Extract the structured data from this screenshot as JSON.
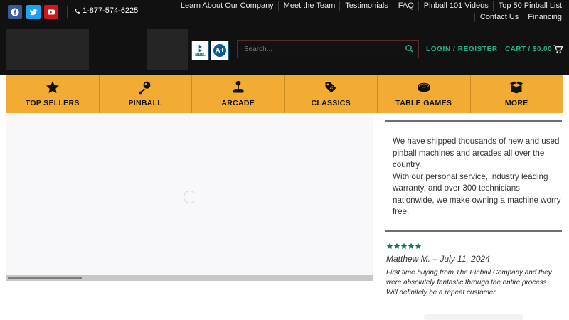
{
  "topbar": {
    "phone": "1-877-574-6225",
    "social": [
      "facebook-icon",
      "twitter-icon",
      "youtube-icon"
    ],
    "links": [
      "Learn About Our Company",
      "Meet the Team",
      "Testimonials",
      "FAQ",
      "Pinball 101 Videos",
      "Top 50 Pinball List",
      "Contact Us",
      "Financing"
    ]
  },
  "header": {
    "bbb_text": "BBB.",
    "bbb_rating": "A+",
    "search_placeholder": "Search...",
    "login": "LOGIN / REGISTER",
    "cart": "CART / $0.00"
  },
  "categories": [
    {
      "label": "TOP SELLERS",
      "icon": "star-icon"
    },
    {
      "label": "PINBALL",
      "icon": "pinball-icon"
    },
    {
      "label": "ARCADE",
      "icon": "joystick-icon"
    },
    {
      "label": "CLASSICS",
      "icon": "tag-icon"
    },
    {
      "label": "TABLE GAMES",
      "icon": "puck-icon"
    },
    {
      "label": "MORE",
      "icon": "box-icon"
    }
  ],
  "pitch": {
    "para1": "We have shipped thousands of new and used pinball machines and arcades all over the country.",
    "para2": "With our personal service, industry leading warranty, and over 300 technicians nationwide, we make owning a machine worry free."
  },
  "testimonial": {
    "rating": 5,
    "reviewer": "Matthew M. – July 11, 2024",
    "text": "First time buying from The Pinball Company and they were absolutely fantastic through the entire process. Will definitely be a repeat customer."
  },
  "colors": {
    "accent_orange": "#f2ac33",
    "accent_green": "#26b08a",
    "star_green": "#16735a",
    "bar_black": "#111111"
  }
}
